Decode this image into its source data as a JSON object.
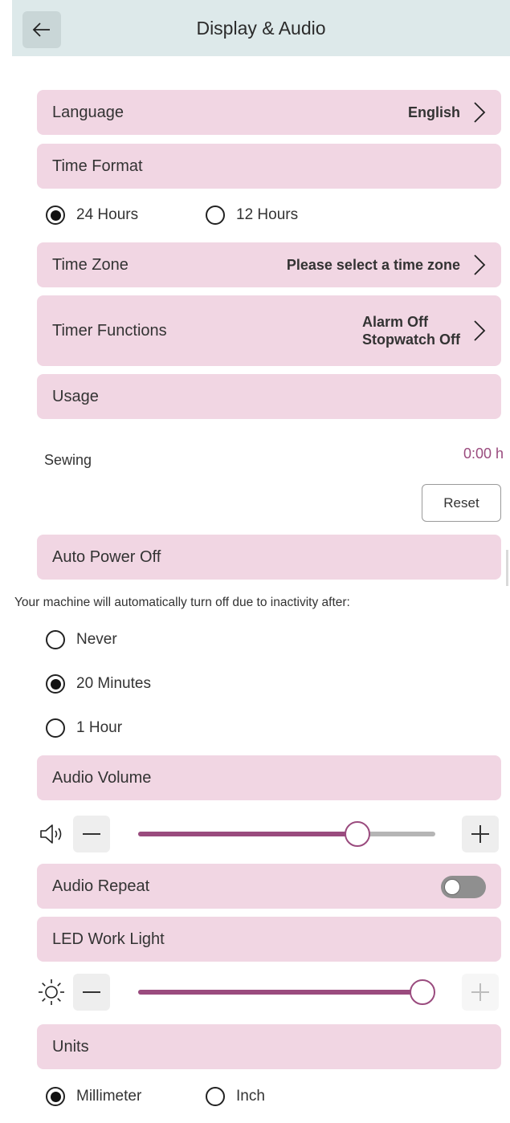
{
  "header": {
    "title": "Display & Audio",
    "back_icon": "arrow-left-icon"
  },
  "language": {
    "label": "Language",
    "value": "English"
  },
  "time_format": {
    "label": "Time Format",
    "options": [
      {
        "label": "24 Hours",
        "selected": true
      },
      {
        "label": "12 Hours",
        "selected": false
      }
    ]
  },
  "time_zone": {
    "label": "Time Zone",
    "value": "Please select a time zone"
  },
  "timer_functions": {
    "label": "Timer Functions",
    "value_line1": "Alarm Off",
    "value_line2": "Stopwatch Off"
  },
  "usage": {
    "label": "Usage",
    "sewing_label": "Sewing",
    "sewing_value": "0:00 h",
    "reset_label": "Reset"
  },
  "auto_power_off": {
    "label": "Auto Power Off",
    "description": "Your machine will automatically turn off due to inactivity after:",
    "options": [
      {
        "label": "Never",
        "selected": false
      },
      {
        "label": "20 Minutes",
        "selected": true
      },
      {
        "label": "1 Hour",
        "selected": false
      }
    ]
  },
  "audio_volume": {
    "label": "Audio Volume",
    "level": 0.77,
    "icon": "speaker-icon"
  },
  "audio_repeat": {
    "label": "Audio Repeat",
    "enabled": false
  },
  "led_work_light": {
    "label": "LED Work Light",
    "level": 1.0,
    "icon": "sun-icon"
  },
  "units": {
    "label": "Units",
    "options": [
      {
        "label": "Millimeter",
        "selected": true
      },
      {
        "label": "Inch",
        "selected": false
      }
    ]
  },
  "colors": {
    "accent": "#9a4b7e",
    "section_bg": "#f1d6e3",
    "header_bg": "#dde9ea"
  }
}
